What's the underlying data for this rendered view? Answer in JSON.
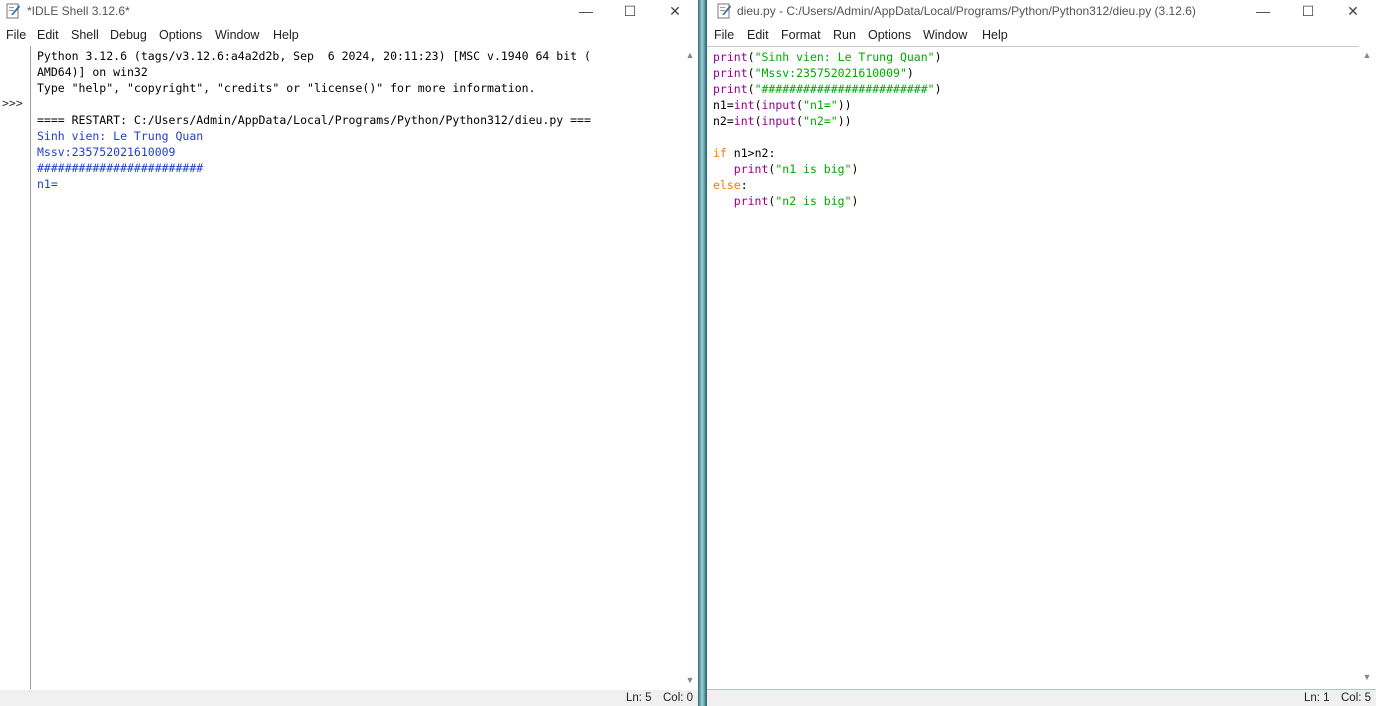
{
  "shell": {
    "title": "*IDLE Shell 3.12.6*",
    "menu": [
      "File",
      "Edit",
      "Shell",
      "Debug",
      "Options",
      "Window",
      "Help"
    ],
    "prompt": ">>>",
    "lines": [
      "Python 3.12.6 (tags/v3.12.6:a4a2d2b, Sep  6 2024, 20:11:23) [MSC v.1940 64 bit (",
      "AMD64)] on win32",
      "Type \"help\", \"copyright\", \"credits\" or \"license()\" for more information.",
      "",
      "==== RESTART: C:/Users/Admin/AppData/Local/Programs/Python/Python312/dieu.py ===",
      "Sinh vien: Le Trung Quan",
      "Mssv:235752021610009",
      "########################",
      "n1="
    ],
    "status": {
      "ln": "Ln: 5",
      "col": "Col: 0"
    }
  },
  "editor": {
    "title": "dieu.py - C:/Users/Admin/AppData/Local/Programs/Python/Python312/dieu.py (3.12.6)",
    "menu": [
      "File",
      "Edit",
      "Format",
      "Run",
      "Options",
      "Window",
      "Help"
    ],
    "code": [
      "print(\"Sinh vien: Le Trung Quan\")",
      "print(\"Mssv:235752021610009\")",
      "print(\"########################\")",
      "n1=int(input(\"n1=\"))",
      "n2=int(input(\"n2=\"))",
      "",
      "if n1>n2:",
      "   print(\"n1 is big\")",
      "else:",
      "   print(\"n2 is big\")"
    ],
    "status": {
      "ln": "Ln: 1",
      "col": "Col: 5"
    }
  },
  "window_controls": {
    "minimize": "—",
    "maximize": "☐",
    "close": "✕"
  },
  "colors": {
    "keyword": "#ff7700",
    "string": "#00aa00",
    "builtin": "#900090",
    "shell_output": "#1f3fcf"
  }
}
